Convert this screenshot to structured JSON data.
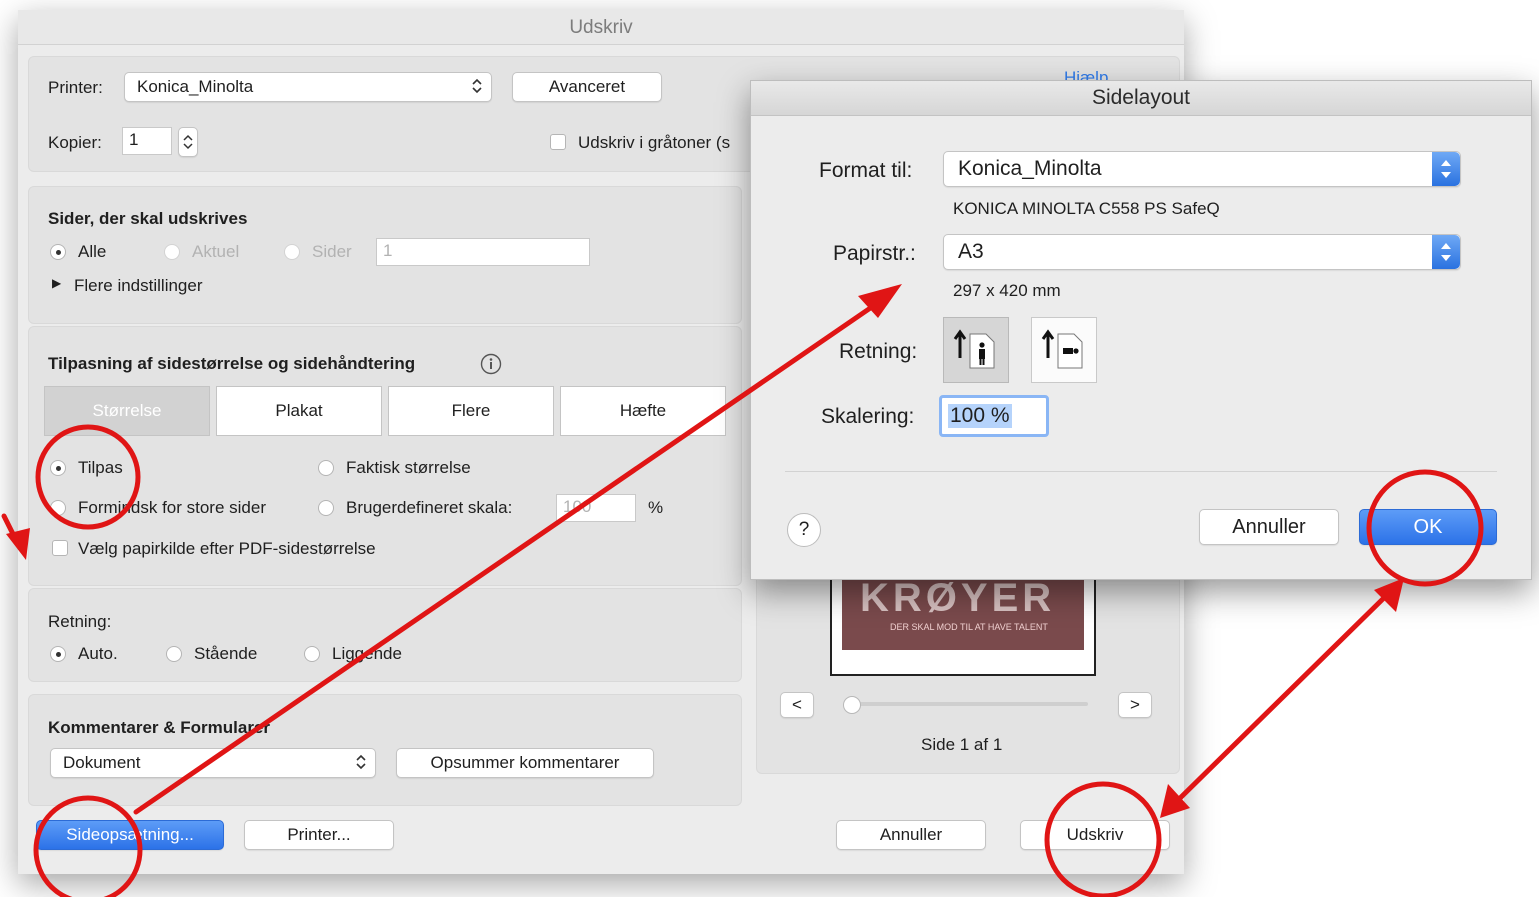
{
  "print_dialog": {
    "title": "Udskriv",
    "printer_label": "Printer:",
    "printer_value": "Konica_Minolta",
    "advanced_button": "Avanceret",
    "help_link": "Hjælp",
    "copies_label": "Kopier:",
    "copies_value": "1",
    "grayscale_label": "Udskriv i gråtoner (s",
    "pages_section": {
      "title": "Sider, der skal udskrives",
      "all": "Alle",
      "current": "Aktuel",
      "pages": "Sider",
      "pages_value": "1",
      "more_settings": "Flere indstillinger"
    },
    "sizing_section": {
      "title": "Tilpasning af sidestørrelse og sidehåndtering",
      "tabs": [
        "Størrelse",
        "Plakat",
        "Flere",
        "Hæfte"
      ],
      "fit": "Tilpas",
      "actual_size": "Faktisk størrelse",
      "shrink": "Formindsk for store sider",
      "custom_scale": "Brugerdefineret skala:",
      "custom_scale_value": "100",
      "percent": "%",
      "paper_source": "Vælg papirkilde efter PDF-sidestørrelse"
    },
    "orientation_section": {
      "title": "Retning:",
      "auto": "Auto.",
      "portrait": "Stående",
      "landscape": "Liggende"
    },
    "comments_section": {
      "title": "Kommentarer & Formularer",
      "select_value": "Dokument",
      "summarize_button": "Opsummer kommentarer"
    },
    "preview": {
      "poster_text": "KRØYER",
      "poster_tagline": "DER SKAL MOD TIL AT HAVE TALENT",
      "prev": "<",
      "next": ">",
      "page_indicator": "Side 1 af 1"
    },
    "page_setup_button": "Sideopsætning...",
    "printer_button": "Printer...",
    "cancel_button": "Annuller",
    "print_button": "Udskriv"
  },
  "page_layout_sheet": {
    "title": "Sidelayout",
    "format_label": "Format til:",
    "format_value": "Konica_Minolta",
    "format_desc": "KONICA MINOLTA C558 PS SafeQ",
    "paper_label": "Papirstr.:",
    "paper_value": "A3",
    "paper_desc": "297 x 420 mm",
    "orientation_label": "Retning:",
    "scale_label": "Skalering:",
    "scale_value": "100 %",
    "help": "?",
    "cancel_button": "Annuller",
    "ok_button": "OK"
  },
  "colors": {
    "annotation_red": "#e01515",
    "accent_blue": "#2f7bea"
  }
}
